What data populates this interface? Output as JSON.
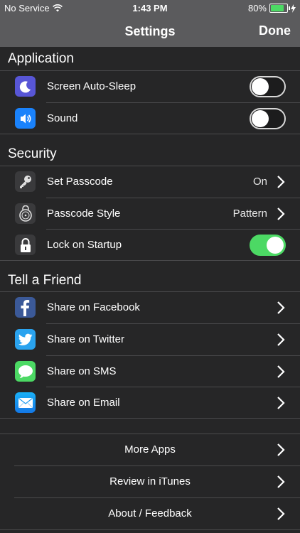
{
  "status_bar": {
    "carrier": "No Service",
    "time": "1:43 PM",
    "battery_percent": "80%",
    "battery_level": 0.8
  },
  "nav": {
    "title": "Settings",
    "done_label": "Done"
  },
  "sections": {
    "application": {
      "header": "Application",
      "rows": [
        {
          "label": "Screen Auto-Sleep",
          "icon": "moon-icon",
          "icon_color": "#5856d6",
          "toggle_on": false
        },
        {
          "label": "Sound",
          "icon": "speaker-icon",
          "icon_color": "#1a82fb",
          "toggle_on": false
        }
      ]
    },
    "security": {
      "header": "Security",
      "rows": [
        {
          "label": "Set Passcode",
          "icon": "key-icon",
          "icon_color": "#3a3a3c",
          "value": "On"
        },
        {
          "label": "Passcode Style",
          "icon": "dial-lock-icon",
          "icon_color": "#3a3a3c",
          "value": "Pattern"
        },
        {
          "label": "Lock on Startup",
          "icon": "padlock-icon",
          "icon_color": "#3a3a3c",
          "toggle_on": true
        }
      ]
    },
    "tell_a_friend": {
      "header": "Tell a Friend",
      "rows": [
        {
          "label": "Share on Facebook",
          "icon": "facebook-icon",
          "icon_color": "#3b5998"
        },
        {
          "label": "Share on Twitter",
          "icon": "twitter-icon",
          "icon_color": "#2aa3ef"
        },
        {
          "label": "Share on SMS",
          "icon": "message-icon",
          "icon_color": "#4cd964"
        },
        {
          "label": "Share on Email",
          "icon": "mail-icon",
          "icon_color": "#1e9cf0"
        }
      ]
    },
    "more": {
      "rows": [
        {
          "label": "More Apps"
        },
        {
          "label": "Review in iTunes"
        },
        {
          "label": "About / Feedback"
        }
      ]
    }
  },
  "colors": {
    "background": "#262627",
    "bar": "#5b5b5d",
    "toggle_on": "#4cd964"
  }
}
